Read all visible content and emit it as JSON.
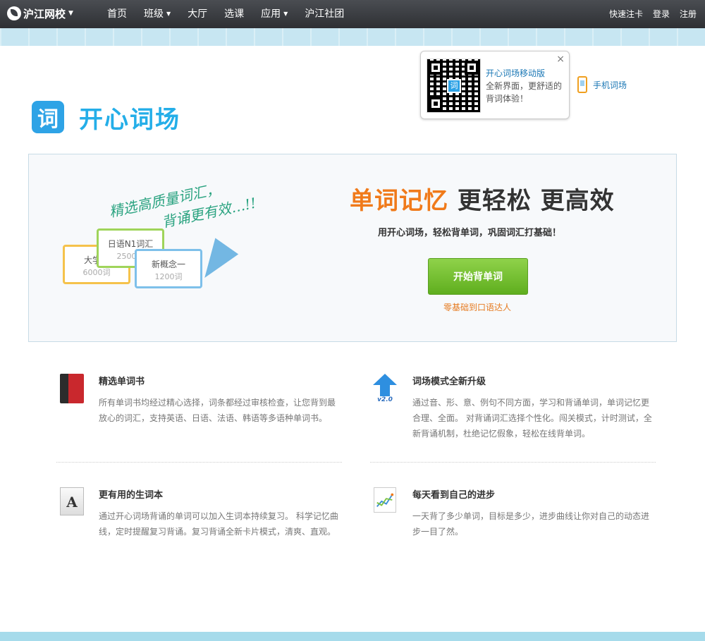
{
  "nav": {
    "logo": "沪江网校",
    "items": [
      {
        "label": "首页",
        "dropdown": false
      },
      {
        "label": "班级",
        "dropdown": true
      },
      {
        "label": "大厅",
        "dropdown": false
      },
      {
        "label": "选课",
        "dropdown": false
      },
      {
        "label": "应用",
        "dropdown": true
      },
      {
        "label": "沪江社团",
        "dropdown": false
      }
    ],
    "right": [
      "快速注卡",
      "登录",
      "注册"
    ]
  },
  "header": {
    "icon_char": "词",
    "app_name": "开心词场",
    "qr_popup": {
      "title": "开心词场移动版",
      "desc": "全新界面，更舒适的背词体验！",
      "close": "×"
    },
    "phone_link": "手机词场"
  },
  "banner": {
    "handwriting_line1": "精选高质量词汇，",
    "handwriting_line2": "背诵更有效…!!",
    "cards": [
      {
        "name": "大学英",
        "count": "6000词"
      },
      {
        "name": "日语N1词汇",
        "count": "2500词"
      },
      {
        "name": "新概念一",
        "count": "1200词"
      }
    ],
    "slogan_orange": "单词记忆",
    "slogan_dark": " 更轻松 更高效",
    "subtitle": "用开心词场，轻松背单词，巩固词汇打基础！",
    "start_button": "开始背单词",
    "zero_link": "零基础到口语达人"
  },
  "features": [
    {
      "icon": "books-icon",
      "title": "精选单词书",
      "desc": "所有单词书均经过精心选择，词条都经过审核检查，让您背到最放心的词汇，支持英语、日语、法语、韩语等多语种单词书。"
    },
    {
      "icon": "upgrade-icon",
      "version": "v2.0",
      "title": "词场模式全新升级",
      "desc": "通过音、形、意、例句不同方面，学习和背诵单词，单词记忆更合理、全面。 对背诵词汇选择个性化。闯关模式，计时测试，全新背诵机制，杜绝记忆假象，轻松在线背单词。"
    },
    {
      "icon": "vocab-book-icon",
      "icon_letter": "A",
      "title": "更有用的生词本",
      "desc": "通过开心词场背诵的单词可以加入生词本持续复习。 科学记忆曲线，定时提醒复习背诵。复习背诵全新卡片模式，清爽、直观。"
    },
    {
      "icon": "progress-chart-icon",
      "title": "每天看到自己的进步",
      "desc": "一天背了多少单词，目标是多少，进步曲线让你对自己的动态进步一目了然。"
    }
  ]
}
